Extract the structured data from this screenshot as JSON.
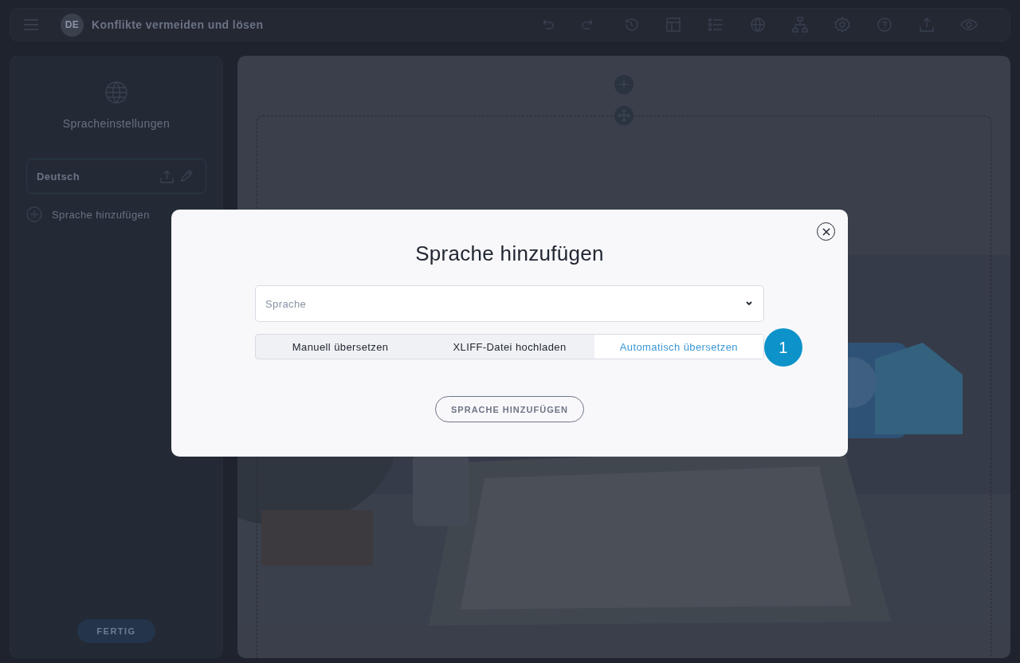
{
  "header": {
    "language_badge": "DE",
    "title": "Konflikte vermeiden und lösen"
  },
  "sidebar": {
    "heading": "Spracheinstellungen",
    "languages": [
      {
        "name": "Deutsch"
      }
    ],
    "add_language": "Sprache hinzufügen",
    "done_button": "FERTIG"
  },
  "modal": {
    "title": "Sprache hinzufügen",
    "language_select": {
      "placeholder": "Sprache"
    },
    "modes": [
      {
        "label": "Manuell übersetzen",
        "selected": false
      },
      {
        "label": "XLIFF-Datei hochladen",
        "selected": false
      },
      {
        "label": "Automatisch übersetzen",
        "selected": true
      }
    ],
    "step_marker": "1",
    "submit_button": "SPRACHE HINZUFÜGEN"
  }
}
